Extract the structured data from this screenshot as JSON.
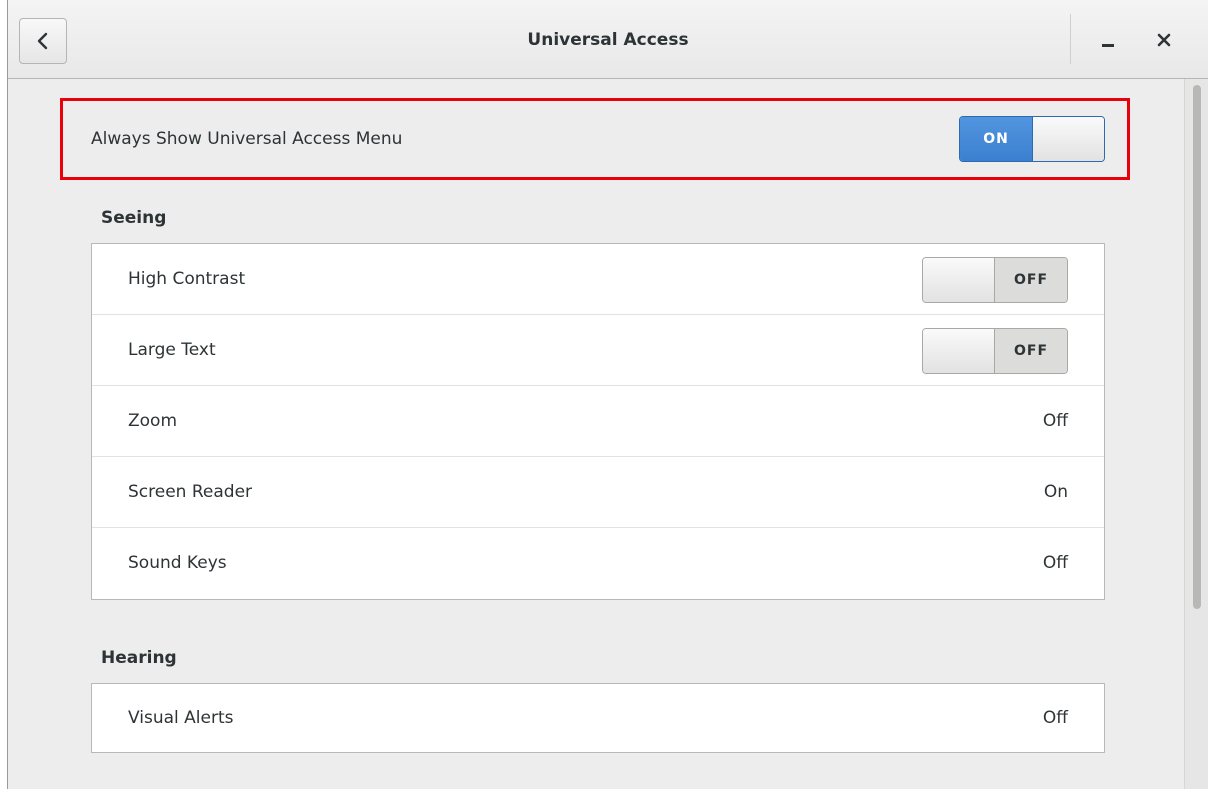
{
  "window": {
    "title": "Universal Access",
    "back_icon": "chevron-left-icon",
    "minimize_icon": "minimize-icon",
    "close_icon": "close-icon"
  },
  "always_show": {
    "label": "Always Show Universal Access Menu",
    "switch_label": "ON",
    "state": "on",
    "highlight_color": "#e8000b"
  },
  "seeing": {
    "title": "Seeing",
    "rows": [
      {
        "label": "High Contrast",
        "type": "switch",
        "value": "OFF"
      },
      {
        "label": "Large Text",
        "type": "switch",
        "value": "OFF"
      },
      {
        "label": "Zoom",
        "type": "value",
        "value": "Off"
      },
      {
        "label": "Screen Reader",
        "type": "value",
        "value": "On"
      },
      {
        "label": "Sound Keys",
        "type": "value",
        "value": "Off"
      }
    ]
  },
  "hearing": {
    "title": "Hearing",
    "rows": [
      {
        "label": "Visual Alerts",
        "type": "value",
        "value": "Off"
      }
    ]
  },
  "colors": {
    "accent": "#3b80d0",
    "background": "#ededed"
  }
}
